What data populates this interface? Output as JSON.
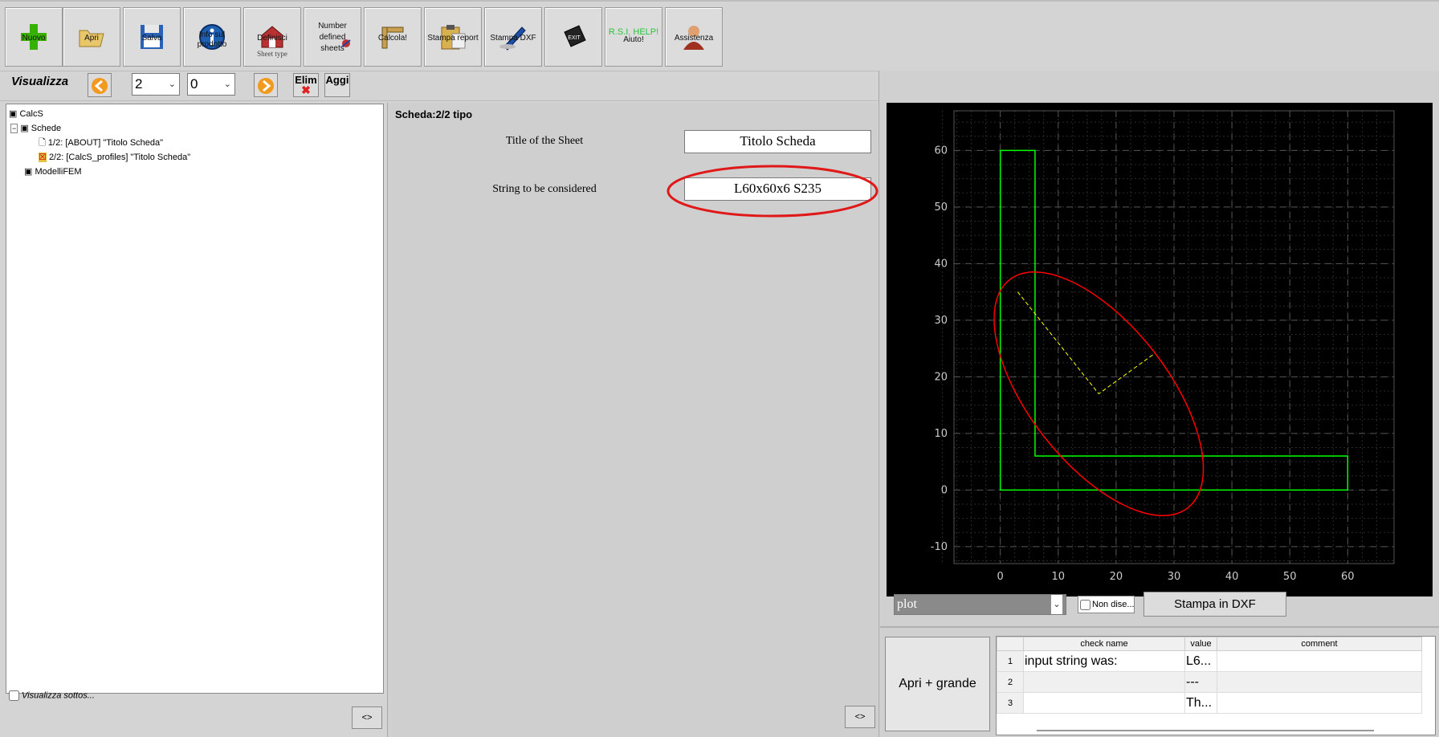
{
  "toolbar": {
    "buttons": [
      {
        "label": "Nuovo",
        "icon": "plus-icon"
      },
      {
        "label": "Apri",
        "icon": "folder-open-icon"
      },
      {
        "label": "Salva",
        "icon": "floppy-disk-icon"
      },
      {
        "label": "Info sul prodotto",
        "icon": "info-icon"
      },
      {
        "label": "Definisci",
        "sublabel": "Sheet type",
        "icon": "house-icon"
      },
      {
        "label": "Number",
        "sublabel1": "defined",
        "sublabel2": "sheets",
        "icon": "number-icon"
      },
      {
        "label": "Calcola!",
        "icon": "ruler-icon"
      },
      {
        "label": "Stampa report",
        "icon": "clipboard-icon"
      },
      {
        "label": "Stampa DXF",
        "icon": "pen-icon"
      },
      {
        "label": "EXIT",
        "icon": "exit-icon"
      },
      {
        "label": "Aiuto!",
        "sublabel": "R.S.I. HELP!",
        "icon": "help-icon"
      },
      {
        "label": "Assistenza",
        "icon": "person-icon"
      }
    ]
  },
  "nav": {
    "title": "Visualizza",
    "combo1": "2",
    "combo2": "0",
    "delete_label": "Elim",
    "add_label": "Aggi"
  },
  "tree": {
    "root": "CalcS",
    "schede": "Schede",
    "item1": "1/2: [ABOUT] \"Titolo Scheda\"",
    "item2": "2/2: [CalcS_profiles] \"Titolo Scheda\"",
    "modelli": "ModelliFEM",
    "checkbox_label": "Visualizza sottos...",
    "toggle_label": "<>"
  },
  "sheet": {
    "header": "Scheda:2/2 tipo",
    "title_label": "Title of the Sheet",
    "title_value": "Titolo Scheda",
    "string_label": "String to be considered",
    "string_value": "L60x60x6 S235",
    "toggle_label": "<>"
  },
  "plot": {
    "select_value": "plot",
    "checkbox_label": "Non dise...",
    "dxf_button": "Stampa in DXF",
    "open_big_button": "Apri + grande",
    "colors": {
      "background": "#000000",
      "profile": "#00ff00",
      "ellipse": "#ff0000",
      "axes": "#ffff00",
      "grid": "#555555"
    }
  },
  "chart_data": {
    "type": "line",
    "xlim": [
      -8,
      68
    ],
    "ylim": [
      -13,
      67
    ],
    "x_ticks": [
      "0",
      "10",
      "20",
      "30",
      "40",
      "50",
      "60"
    ],
    "y_ticks": [
      "60",
      "50",
      "40",
      "30",
      "20",
      "10",
      "0",
      "-10"
    ],
    "grid": true,
    "series": [
      {
        "x": [
          0,
          6,
          6,
          60,
          60,
          0,
          0
        ],
        "y": [
          60,
          60,
          6,
          6,
          0,
          0,
          60
        ]
      }
    ]
  },
  "results": {
    "columns": [
      "check name",
      "value",
      "comment"
    ],
    "rows": [
      {
        "n": "1",
        "check": "input string was:",
        "value": "L6...",
        "comment": ""
      },
      {
        "n": "2",
        "check": "",
        "value": "---",
        "comment": ""
      },
      {
        "n": "3",
        "check": "",
        "value": "Th...",
        "comment": ""
      }
    ]
  }
}
